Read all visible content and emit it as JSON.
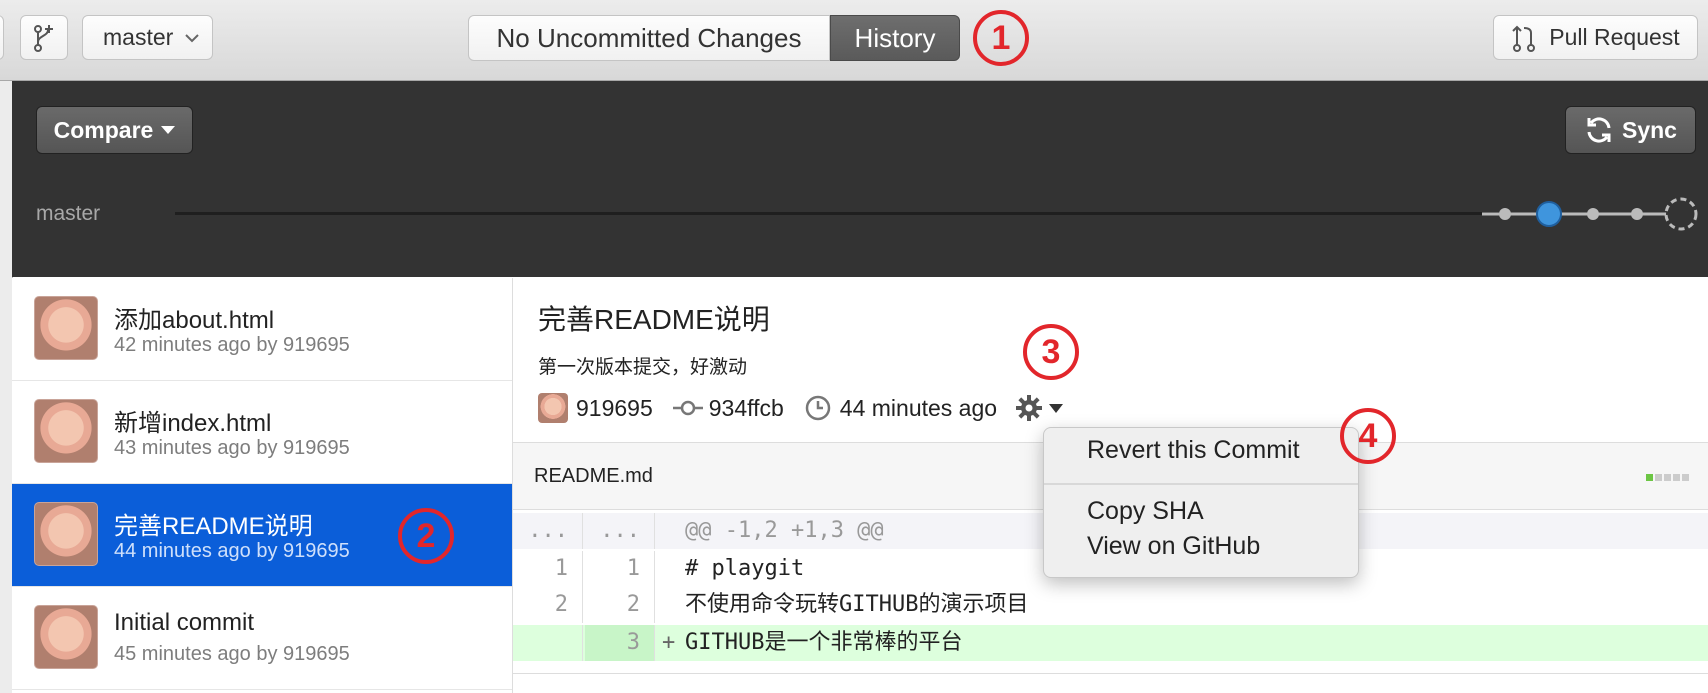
{
  "toolbar": {
    "branch": "master",
    "tab_uncommitted": "No Uncommitted Changes",
    "tab_history": "History",
    "pull_request": "Pull Request"
  },
  "dark": {
    "compare": "Compare",
    "sync": "Sync",
    "branch_label": "master"
  },
  "commits": [
    {
      "title": "添加about.html",
      "sub": "42 minutes ago by 919695"
    },
    {
      "title": "新增index.html",
      "sub": "43 minutes ago by 919695"
    },
    {
      "title": "完善README说明",
      "sub": "44 minutes ago by 919695"
    },
    {
      "title": "Initial commit",
      "sub": "45 minutes ago by 919695"
    }
  ],
  "detail": {
    "title": "完善README说明",
    "description": "第一次版本提交，好激动",
    "author": "919695",
    "sha": "934ffcb",
    "time": "44 minutes ago"
  },
  "file": {
    "name": "README.md"
  },
  "diff": [
    {
      "old": "...",
      "new": "...",
      "code": "@@ -1,2 +1,3 @@",
      "type": "hunk"
    },
    {
      "old": "1",
      "new": "1",
      "code": "# playgit",
      "type": "context"
    },
    {
      "old": "2",
      "new": "2",
      "code": "不使用命令玩转GITHUB的演示项目",
      "type": "context"
    },
    {
      "old": "",
      "new": "3",
      "code": "GITHUB是一个非常棒的平台",
      "type": "add",
      "marker": "+"
    }
  ],
  "menu": {
    "revert": "Revert this Commit",
    "copy_sha": "Copy SHA",
    "view_github": "View on GitHub"
  },
  "annotations": {
    "a1": "1",
    "a2": "2",
    "a3": "3",
    "a4": "4"
  },
  "colors": {
    "selected": "#0b5ed9",
    "badge": "#e2262b",
    "timeline_dot": "#3f95dd",
    "add_bg": "#ddffdd"
  }
}
